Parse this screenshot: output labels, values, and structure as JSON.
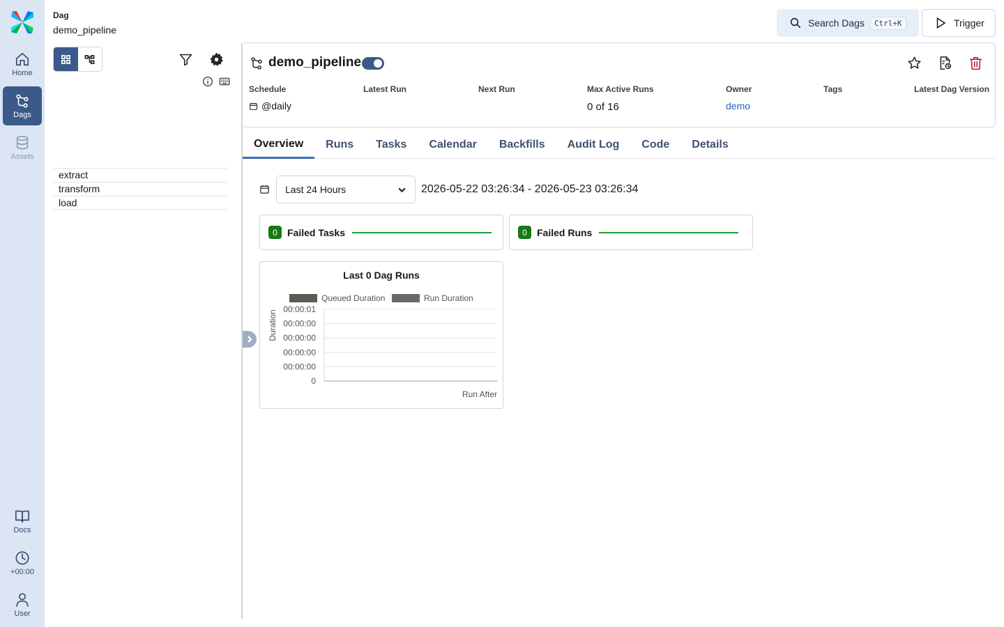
{
  "sidebar": {
    "items": [
      {
        "label": "Home",
        "icon": "home-icon"
      },
      {
        "label": "Dags",
        "icon": "dags-icon"
      },
      {
        "label": "Assets",
        "icon": "assets-icon"
      }
    ],
    "bottom": [
      {
        "label": "Docs",
        "icon": "book-icon"
      },
      {
        "label": "+00:00",
        "icon": "clock-icon"
      },
      {
        "label": "User",
        "icon": "user-icon"
      }
    ]
  },
  "breadcrumb": {
    "label": "Dag",
    "value": "demo_pipeline"
  },
  "header": {
    "search_label": "Search Dags",
    "search_shortcut": "Ctrl+K",
    "trigger_label": "Trigger"
  },
  "tasks": [
    "extract",
    "transform",
    "load"
  ],
  "dag": {
    "title": "demo_pipeline",
    "paused": false,
    "meta": {
      "schedule_label": "Schedule",
      "schedule_value": "@daily",
      "latest_run_label": "Latest Run",
      "next_run_label": "Next Run",
      "max_active_runs_label": "Max Active Runs",
      "max_active_runs_value": "0 of 16",
      "owner_label": "Owner",
      "owner_value": "demo",
      "tags_label": "Tags",
      "latest_version_label": "Latest Dag Version"
    }
  },
  "tabs": [
    "Overview",
    "Runs",
    "Tasks",
    "Calendar",
    "Backfills",
    "Audit Log",
    "Code",
    "Details"
  ],
  "overview": {
    "range_select": "Last 24 Hours",
    "range_text": "2026-05-22 03:26:34 - 2026-05-23 03:26:34",
    "failed_tasks": {
      "count": "0",
      "label": "Failed Tasks"
    },
    "failed_runs": {
      "count": "0",
      "label": "Failed Runs"
    }
  },
  "colors": {
    "accent": "#3b5a89",
    "success": "#147a14",
    "queued": "#5d5a55",
    "run": "#6a6a6a"
  },
  "chart_data": {
    "type": "bar",
    "title": "Last 0 Dag Runs",
    "xlabel": "Run After",
    "ylabel": "Duration",
    "categories": [],
    "series": [
      {
        "name": "Queued Duration",
        "values": []
      },
      {
        "name": "Run Duration",
        "values": []
      }
    ],
    "yticks": [
      "0",
      "00:00:00",
      "00:00:00",
      "00:00:00",
      "00:00:00",
      "00:00:01"
    ],
    "legend": "top",
    "grid": true
  }
}
